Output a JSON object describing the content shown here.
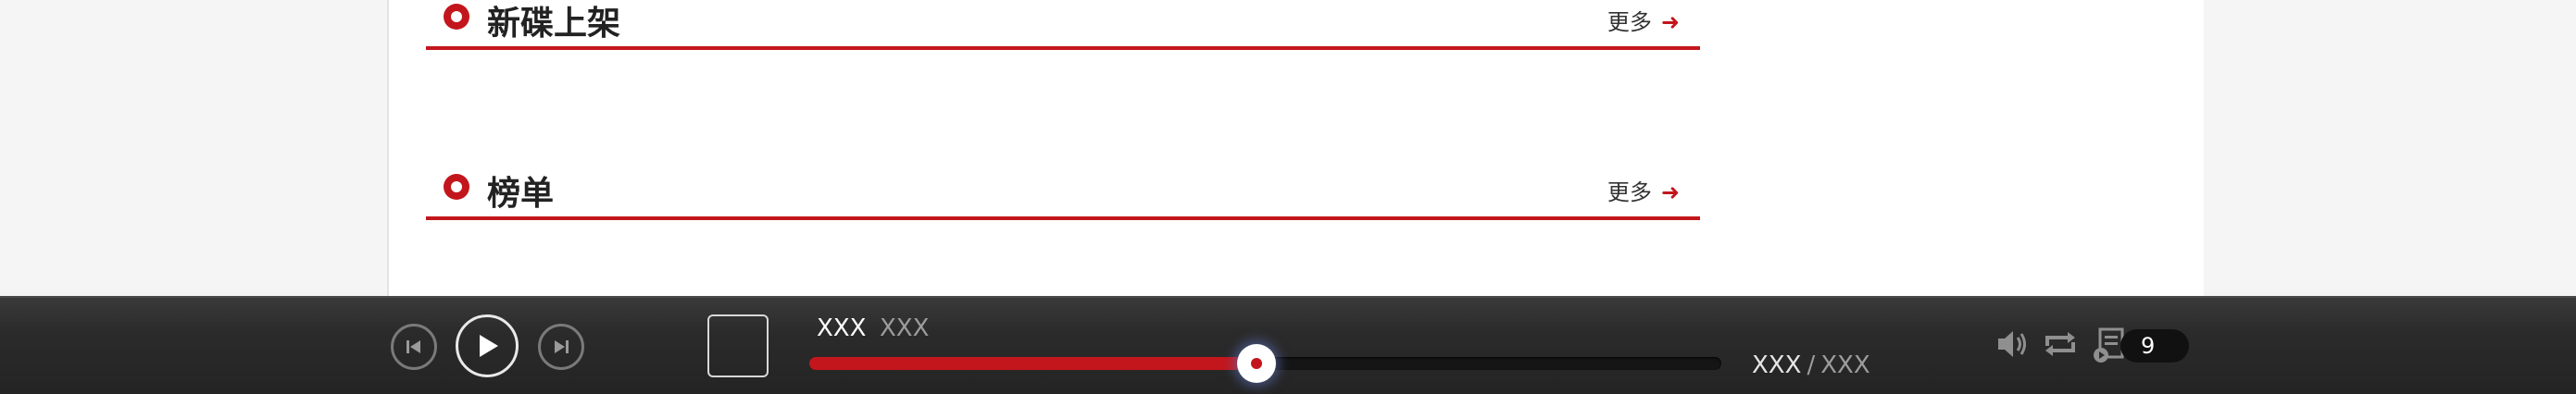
{
  "sections": [
    {
      "title": "新碟上架",
      "more": "更多",
      "more_arrow": "➜"
    },
    {
      "title": "榜单",
      "more": "更多",
      "more_arrow": "➜"
    }
  ],
  "player": {
    "song_name": "XXX",
    "singer": "XXX",
    "progress_fraction": 0.49,
    "current_time": "XXX",
    "separator": "/",
    "total_time": "XXX",
    "playlist_count": "9",
    "icons": [
      "prev-icon",
      "play-icon",
      "next-icon",
      "volume-icon",
      "loop-icon",
      "playlist-icon"
    ]
  },
  "colors": {
    "accent": "#c3161c",
    "player_bg": "#2b2b2b",
    "page_bg": "#f5f5f5"
  }
}
